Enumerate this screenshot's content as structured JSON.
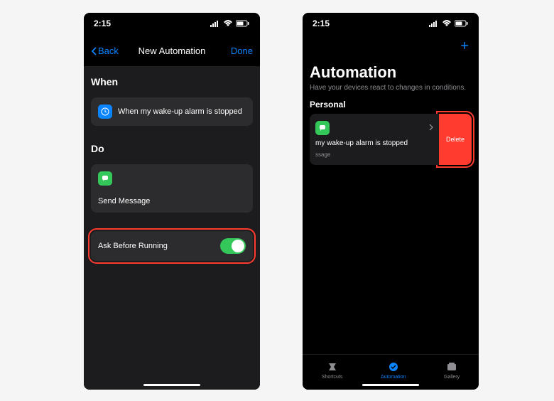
{
  "statusBar": {
    "time": "2:15"
  },
  "left": {
    "nav": {
      "back": "Back",
      "title": "New Automation",
      "done": "Done"
    },
    "when": {
      "header": "When",
      "trigger": "When my wake-up alarm is stopped"
    },
    "do": {
      "header": "Do",
      "action": "Send Message"
    },
    "toggle": {
      "label": "Ask Before Running",
      "on": true
    }
  },
  "right": {
    "title": "Automation",
    "subtitle": "Have your devices react to changes in conditions.",
    "personal": "Personal",
    "automation": {
      "title": "my wake-up alarm is stopped",
      "sub": "ssage",
      "delete": "Delete"
    },
    "tabs": {
      "shortcuts": "Shortcuts",
      "automation": "Automation",
      "gallery": "Gallery"
    }
  }
}
